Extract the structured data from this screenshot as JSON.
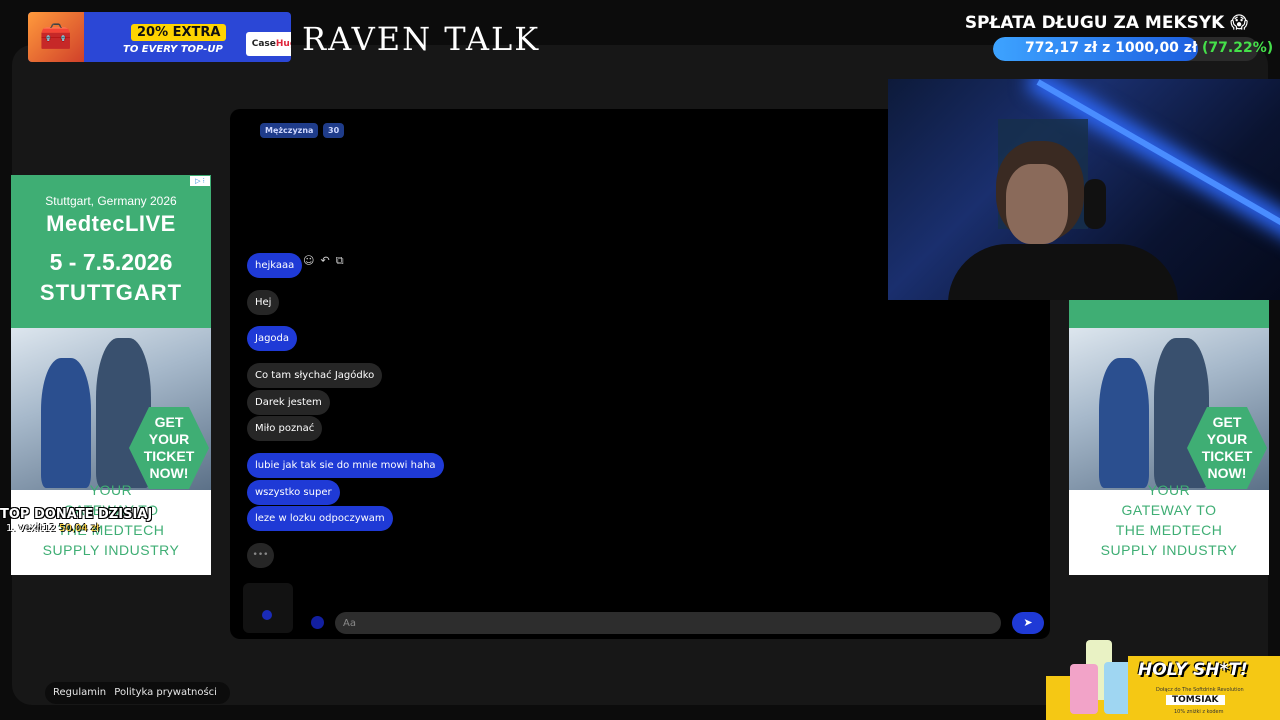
{
  "promo": {
    "extra": "20% EXTRA",
    "subtitle": "TO EVERY TOP-UP",
    "brand_prefix": "Case",
    "brand_suffix": "Hug"
  },
  "site": {
    "logo": "RAVEN TALK"
  },
  "goal": {
    "title": "SPŁATA DŁUGU ZA MEKSYK 😱",
    "current": "772,17 zł",
    "connector": "z",
    "target": "1000,00 zł",
    "percent_label": "(77.22%)",
    "progress": 0.7722
  },
  "ad": {
    "city_line": "Stuttgart, Germany 2026",
    "brand": "MedtecLIVE",
    "dates": "5 - 7.5.2026",
    "city": "STUTTGART",
    "cta": [
      "GET",
      "YOUR",
      "TICKET",
      "NOW!"
    ],
    "tagline": [
      "YOUR",
      "GATEWAY TO",
      "THE MEDTECH",
      "SUPPLY INDUSTRY"
    ],
    "choices": "▷ ⁝"
  },
  "top_donate": {
    "title": "TOP DONATE DZISIAJ",
    "user": "1. vexit12",
    "amount": "50,04 zł"
  },
  "chat": {
    "tags": {
      "gender": "Mężczyzna",
      "age": "30"
    },
    "messages": [
      {
        "text": "hejkaaa",
        "from": "me"
      },
      {
        "text": "Hej",
        "from": "them"
      },
      {
        "text": "Jagoda",
        "from": "me"
      },
      {
        "text": "Co tam słychać Jagódko",
        "from": "them"
      },
      {
        "text": "Darek jestem",
        "from": "them"
      },
      {
        "text": "Miło poznać",
        "from": "them"
      },
      {
        "text": "lubie jak tak sie do mnie mowi haha",
        "from": "me"
      },
      {
        "text": "wszystko super",
        "from": "me"
      },
      {
        "text": "leze w lozku odpoczywam",
        "from": "me"
      }
    ],
    "actions": {
      "emoji": "☺",
      "reply": "↶",
      "copy": "⧉"
    },
    "typing": "•••",
    "input_placeholder": "Aa",
    "send_icon": "➤"
  },
  "footer": {
    "terms": "Regulamin",
    "privacy": "Polityka prywatności"
  },
  "sponsor": {
    "title": "HOLY SH*T!",
    "subtitle": "Dołącz do The Softdrink Revolution",
    "name": "TOMSIAK",
    "note": "10% zniżki z kodem"
  },
  "colors": {
    "accent_blue": "#1f3ad6",
    "ad_green": "#3fae74",
    "goal_green": "#45e04a"
  }
}
